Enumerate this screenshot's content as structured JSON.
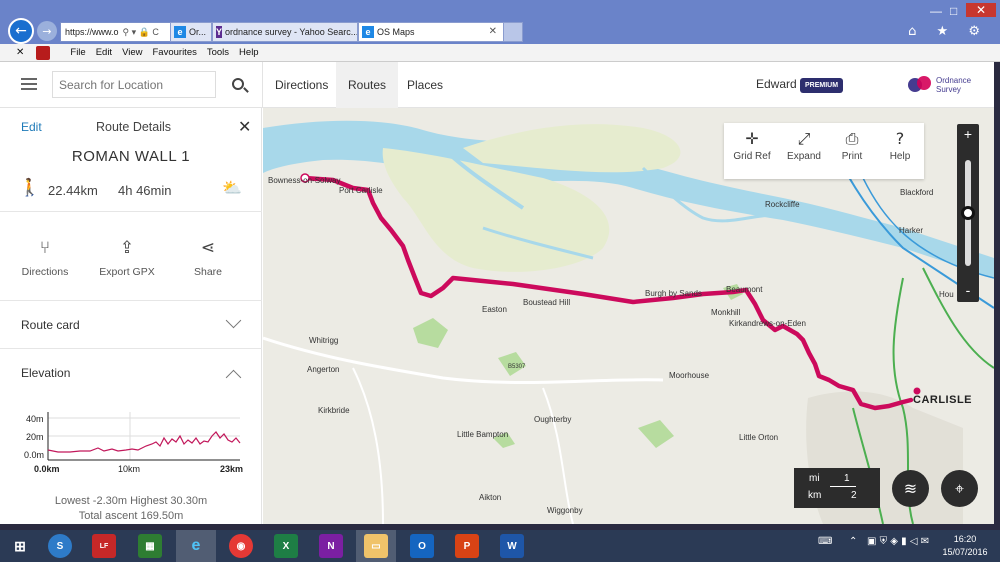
{
  "browser": {
    "address": "https://www.o",
    "address_icons": "⚲ ▾ 🔒 C",
    "tabs": [
      {
        "label": "Or...",
        "fav": "e"
      },
      {
        "label": "ordnance survey - Yahoo Searc...",
        "fav": "Y"
      },
      {
        "label": "OS Maps",
        "fav": "e"
      }
    ],
    "window_controls": [
      "—",
      "□",
      "✕"
    ],
    "top_icons": "⌂ ★ ⚙",
    "menu": [
      "File",
      "Edit",
      "View",
      "Favourites",
      "Tools",
      "Help"
    ]
  },
  "app": {
    "search_placeholder": "Search for Location",
    "nav_tabs": [
      "Directions",
      "Routes",
      "Places"
    ],
    "active_tab": "Routes",
    "user": "Edward",
    "premium": "PREMIUM",
    "logo_text": "Ordnance Survey"
  },
  "panel": {
    "edit": "Edit",
    "title": "Route Details",
    "route_name": "ROMAN WALL 1",
    "distance": "22.44km",
    "duration": "4h 46min",
    "actions": [
      {
        "label": "Directions",
        "icon": "split-arrow-icon"
      },
      {
        "label": "Export GPX",
        "icon": "export-icon"
      },
      {
        "label": "Share",
        "icon": "share-icon"
      }
    ],
    "route_card": "Route card",
    "elevation": "Elevation",
    "elevation_chart": {
      "y_ticks": [
        "40m",
        "20m",
        "0.0m"
      ],
      "x_ticks": [
        "0.0km",
        "10km",
        "23km"
      ]
    },
    "stats_line1": "Lowest -2.30m Highest 30.30m",
    "stats_line2": "Total ascent 169.50m"
  },
  "map": {
    "tools": [
      {
        "label": "Grid Ref",
        "icon": "crosshair-icon"
      },
      {
        "label": "Expand",
        "icon": "expand-icon"
      },
      {
        "label": "Print",
        "icon": "print-icon"
      },
      {
        "label": "Help",
        "icon": "help-icon"
      }
    ],
    "zoom_in": "+",
    "zoom_out": "-",
    "scale": {
      "mi": "mi",
      "km": "km",
      "mi_val": "1",
      "km_val": "2"
    },
    "labels": [
      "Bowness-on-Solway",
      "Port Carlisle",
      "Rockcliffe",
      "Blackford",
      "Harker",
      "Boustead Hill",
      "Easton",
      "Burgh by Sands",
      "Beaumont",
      "Monkhill",
      "Kirkandrews-on-Eden",
      "Whitrigg",
      "Angerton",
      "Kirkbride",
      "Moorhouse",
      "Oughterby",
      "Little Bampton",
      "Little Orton",
      "Aikton",
      "Wiggonby",
      "CARLISLE",
      "B5307",
      "Hou"
    ]
  },
  "taskbar": {
    "time": "16:20",
    "date": "15/07/2016"
  }
}
